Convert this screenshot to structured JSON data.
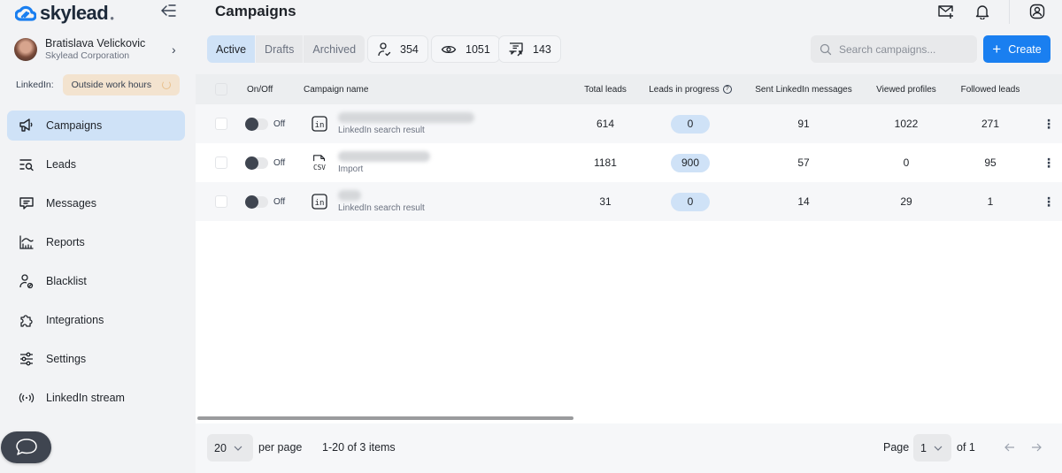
{
  "brand": {
    "name": "skylead",
    "accent": "#1a7ff0"
  },
  "sidebar": {
    "profile": {
      "name": "Bratislava Velickovic",
      "company": "Skylead Corporation"
    },
    "linkedin": {
      "label": "LinkedIn:",
      "status": "Outside work hours"
    },
    "items": [
      {
        "label": "Campaigns",
        "icon": "megaphone-icon",
        "active": true
      },
      {
        "label": "Leads",
        "icon": "leads-search-icon",
        "active": false
      },
      {
        "label": "Messages",
        "icon": "message-icon",
        "active": false
      },
      {
        "label": "Reports",
        "icon": "chart-icon",
        "active": false
      },
      {
        "label": "Blacklist",
        "icon": "user-blocked-icon",
        "active": false
      },
      {
        "label": "Integrations",
        "icon": "puzzle-icon",
        "active": false
      },
      {
        "label": "Settings",
        "icon": "sliders-icon",
        "active": false
      },
      {
        "label": "LinkedIn stream",
        "icon": "broadcast-icon",
        "active": false
      }
    ]
  },
  "header": {
    "title": "Campaigns"
  },
  "tabs": [
    {
      "label": "Active",
      "active": true
    },
    {
      "label": "Drafts",
      "active": false
    },
    {
      "label": "Archived",
      "active": false
    }
  ],
  "stats": [
    {
      "icon": "user-check-icon",
      "value": "354"
    },
    {
      "icon": "eye-icon",
      "value": "1051"
    },
    {
      "icon": "message-reply-icon",
      "value": "143"
    }
  ],
  "search": {
    "placeholder": "Search campaigns..."
  },
  "create_label": "Create",
  "table": {
    "columns": {
      "onoff": "On/Off",
      "name": "Campaign name",
      "total": "Total leads",
      "progress": "Leads in progress",
      "sent": "Sent LinkedIn messages",
      "viewed": "Viewed profiles",
      "followed": "Followed leads"
    },
    "rows": [
      {
        "status": "Off",
        "source": "linkedin",
        "source_label": "LinkedIn search result",
        "total": "614",
        "progress": "0",
        "sent": "91",
        "viewed": "1022",
        "followed": "271"
      },
      {
        "status": "Off",
        "source": "csv",
        "source_label": "Import",
        "total": "1181",
        "progress": "900",
        "sent": "57",
        "viewed": "0",
        "followed": "95"
      },
      {
        "status": "Off",
        "source": "linkedin",
        "source_label": "LinkedIn search result",
        "total": "31",
        "progress": "0",
        "sent": "14",
        "viewed": "29",
        "followed": "1"
      }
    ]
  },
  "footer": {
    "per_page_value": "20",
    "per_page_label": "per page",
    "range": "1-20 of 3 items",
    "page_label": "Page",
    "page_value": "1",
    "of_label": "of 1"
  }
}
